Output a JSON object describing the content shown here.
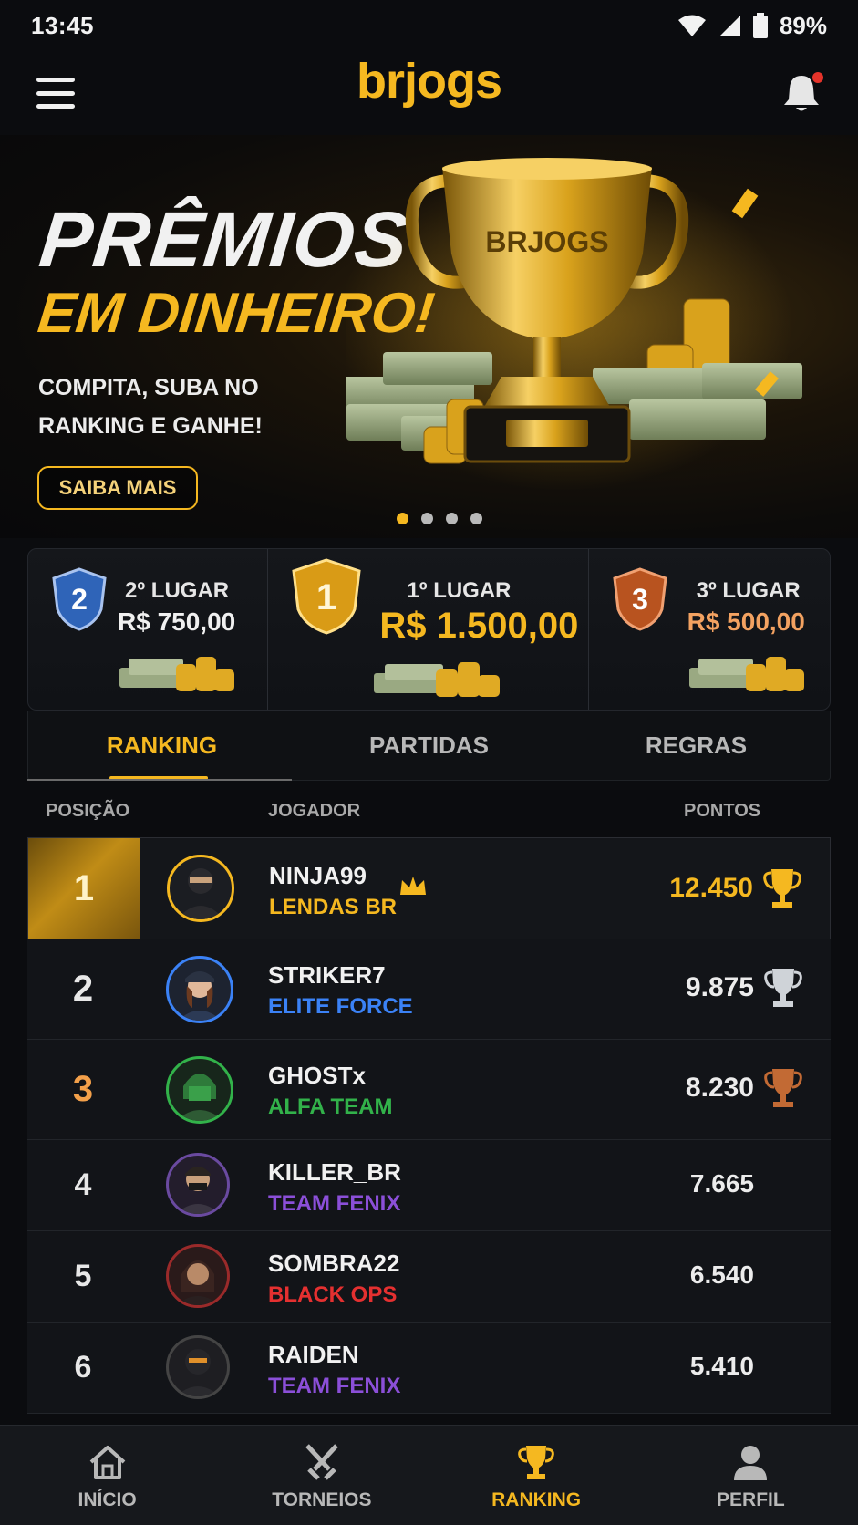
{
  "status_bar": {
    "time": "13:45",
    "battery": "89%"
  },
  "header": {
    "logo": "brjogs",
    "has_notification": true
  },
  "banner": {
    "title_line1": "PRÊMIOS",
    "title_line2": "EM DINHEIRO!",
    "subtitle": "COMPITA, SUBA NO RANKING E GANHE!",
    "cta_label": "SAIBA MAIS",
    "trophy_engraving": "BRJOGS",
    "carousel_count": 4,
    "carousel_active": 0
  },
  "prizes": [
    {
      "rank_badge": "2",
      "place": "2º LUGAR",
      "amount": "R$ 750,00",
      "color": "#3b7bd6"
    },
    {
      "rank_badge": "1",
      "place": "1º LUGAR",
      "amount": "R$ 1.500,00",
      "color": "#f5b820"
    },
    {
      "rank_badge": "3",
      "place": "3º LUGAR",
      "amount": "R$ 500,00",
      "color": "#d0652e"
    }
  ],
  "tabs": [
    {
      "label": "RANKING",
      "active": true
    },
    {
      "label": "PARTIDAS",
      "active": false
    },
    {
      "label": "REGRAS",
      "active": false
    }
  ],
  "table_headers": {
    "position": "POSIÇÃO",
    "player": "JOGADOR",
    "points": "PONTOS"
  },
  "ranking": [
    {
      "pos": "1",
      "name": "NINJA99",
      "team": "LENDAS BR",
      "team_color": "#f5b820",
      "points": "12.450",
      "trophy": "gold",
      "crown": true
    },
    {
      "pos": "2",
      "name": "STRIKER7",
      "team": "ELITE FORCE",
      "team_color": "#3b82f6",
      "points": "9.875",
      "trophy": "silver",
      "crown": false
    },
    {
      "pos": "3",
      "name": "GHOSTx",
      "team": "ALFA TEAM",
      "team_color": "#32b24a",
      "points": "8.230",
      "trophy": "bronze",
      "crown": false
    },
    {
      "pos": "4",
      "name": "KILLER_BR",
      "team": "TEAM FENIX",
      "team_color": "#8b4fd8",
      "points": "7.665",
      "trophy": "none",
      "crown": false
    },
    {
      "pos": "5",
      "name": "SOMBRA22",
      "team": "BLACK OPS",
      "team_color": "#e53030",
      "points": "6.540",
      "trophy": "none",
      "crown": false
    },
    {
      "pos": "6",
      "name": "RAIDEN",
      "team": "TEAM FENIX",
      "team_color": "#8b4fd8",
      "points": "5.410",
      "trophy": "none",
      "crown": false
    }
  ],
  "bottom_nav": [
    {
      "label": "INÍCIO",
      "icon": "home-icon",
      "active": false
    },
    {
      "label": "TORNEIOS",
      "icon": "crossed-swords-icon",
      "active": false
    },
    {
      "label": "RANKING",
      "icon": "trophy-icon",
      "active": true
    },
    {
      "label": "PERFIL",
      "icon": "user-icon",
      "active": false
    }
  ]
}
